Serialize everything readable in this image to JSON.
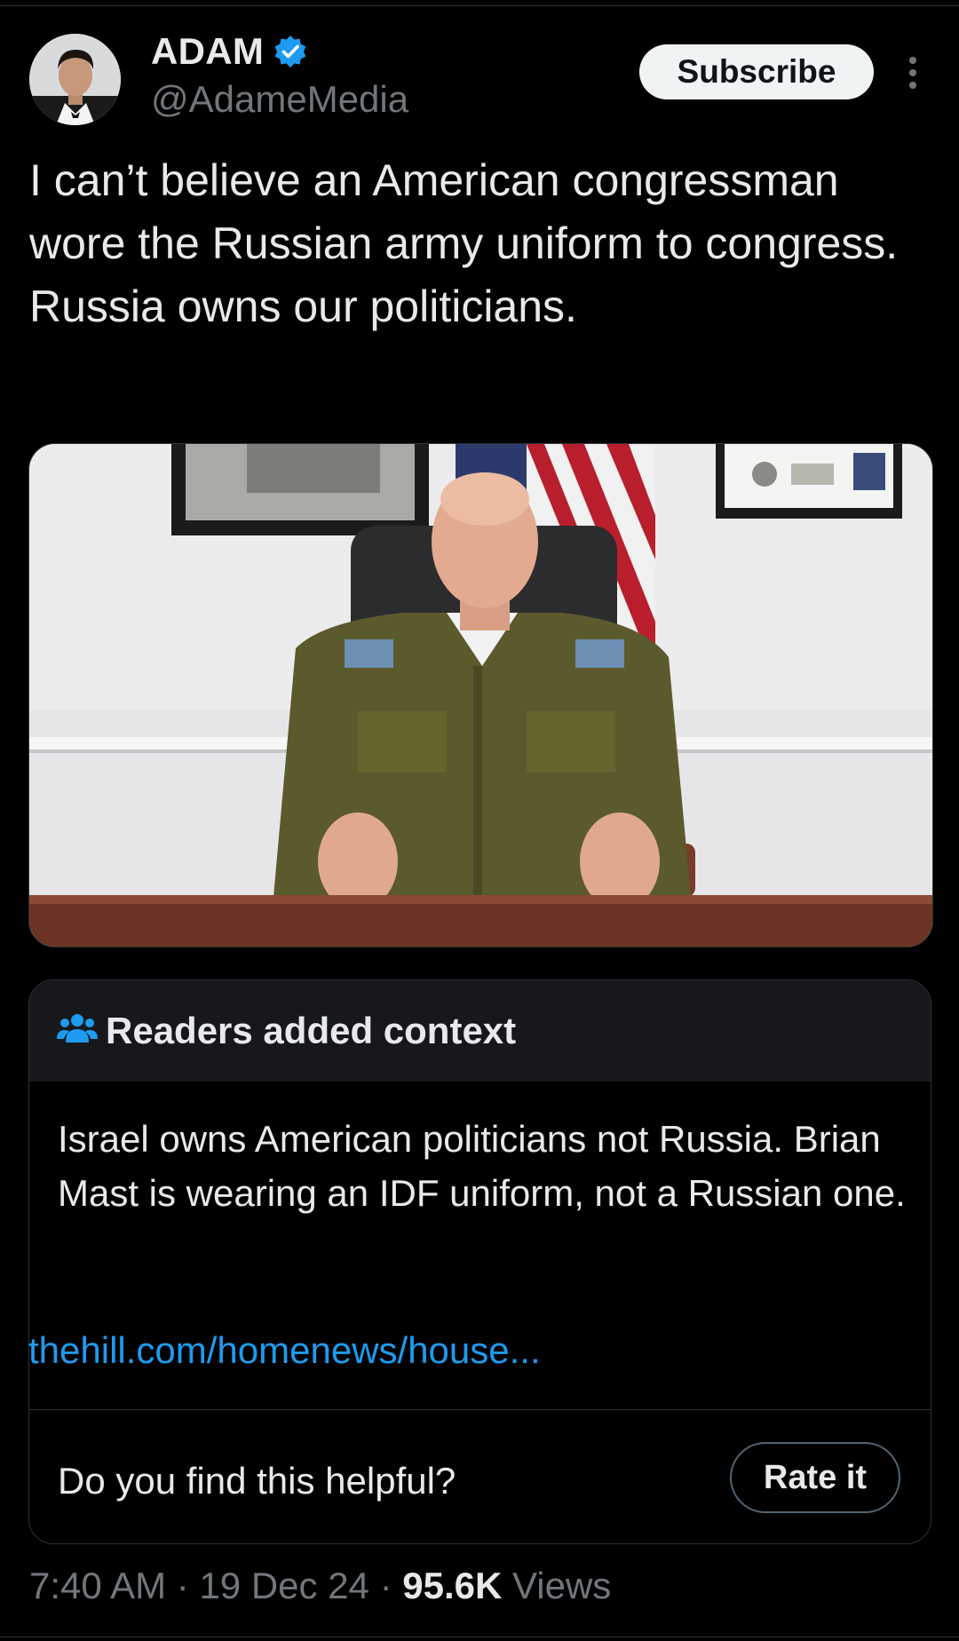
{
  "author": {
    "name": "ADAM",
    "handle": "@AdameMedia",
    "verified": true,
    "verified_color": "#1d9bf0"
  },
  "header": {
    "subscribe_label": "Subscribe",
    "more_icon": "more-vertical-icon"
  },
  "tweet": {
    "text": "I can’t believe an American congressman wore the Russian army uniform to congress. Russia owns our politicians."
  },
  "note": {
    "icon": "people-icon",
    "title": "Readers added context",
    "body": "Israel owns American politicians not Russia. Brian Mast is wearing an IDF uniform, not a Russian one.",
    "link": "thehill.com/homenews/house...",
    "question": "Do you find this helpful?",
    "rate_label": "Rate it"
  },
  "meta": {
    "time": "7:40 AM",
    "separator": "·",
    "date": "19 Dec 24",
    "views_count": "95.6K",
    "views_label": "Views"
  },
  "colors": {
    "background": "#000000",
    "text": "#e7e9ea",
    "muted": "#71767b",
    "link": "#1d9bf0",
    "note_header": "#16181c"
  }
}
